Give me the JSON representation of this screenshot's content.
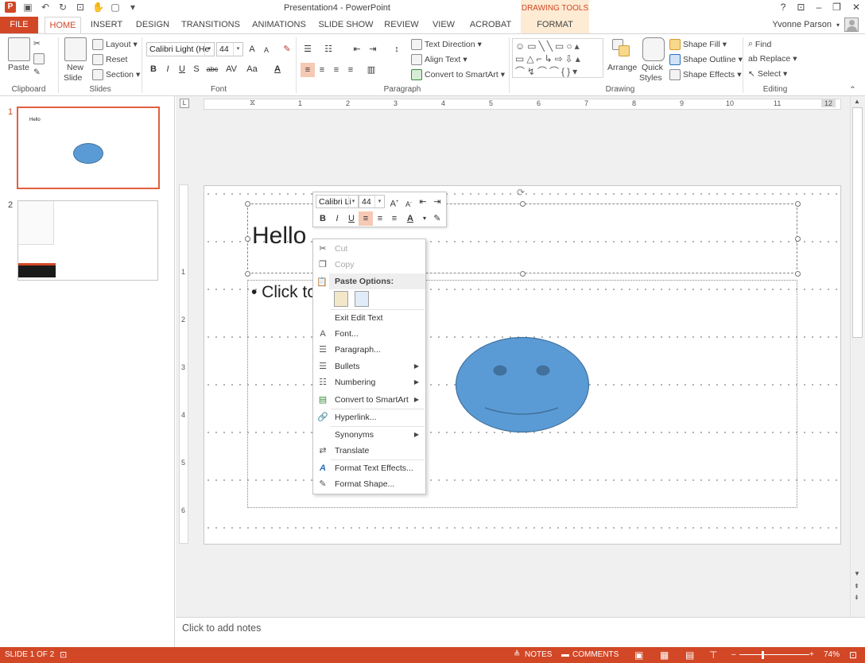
{
  "window": {
    "title": "Presentation4 - PowerPoint",
    "contextual_group": "DRAWING TOOLS",
    "help": "?",
    "controls": [
      "⊡",
      "–",
      "❐",
      "✕"
    ]
  },
  "tabs": {
    "file": "FILE",
    "home": "HOME",
    "insert": "INSERT",
    "design": "DESIGN",
    "transitions": "TRANSITIONS",
    "animations": "ANIMATIONS",
    "slide_show": "SLIDE SHOW",
    "review": "REVIEW",
    "view": "VIEW",
    "acrobat": "ACROBAT",
    "format": "FORMAT"
  },
  "user": {
    "name": "Yvonne Parson"
  },
  "ribbon": {
    "clipboard": {
      "label": "Clipboard",
      "paste": "Paste"
    },
    "slides": {
      "label": "Slides",
      "new_slide": "New",
      "new_slide2": "Slide",
      "layout": "Layout",
      "reset": "Reset",
      "section": "Section"
    },
    "font": {
      "label": "Font",
      "name": "Calibri Light (He",
      "size": "44",
      "bold": "B",
      "italic": "I",
      "underline": "U",
      "strike": "S",
      "shadow": "abc",
      "spacing": "AV",
      "case": "Aa",
      "color": "A",
      "grow": "A",
      "shrink": "A",
      "clear": "✎"
    },
    "paragraph": {
      "label": "Paragraph",
      "text_direction": "Text Direction",
      "align_text": "Align Text",
      "convert_smartart": "Convert to SmartArt"
    },
    "drawing": {
      "label": "Drawing",
      "arrange": "Arrange",
      "quick": "Quick",
      "styles": "Styles",
      "shape_fill": "Shape Fill",
      "shape_outline": "Shape Outline",
      "shape_effects": "Shape Effects"
    },
    "editing": {
      "label": "Editing",
      "find": "Find",
      "replace": "Replace",
      "select": "Select"
    }
  },
  "thumbnails": [
    {
      "num": "1",
      "text": "Hello"
    },
    {
      "num": "2"
    }
  ],
  "ruler": {
    "h": [
      "1",
      "2",
      "3",
      "4",
      "5",
      "6",
      "7",
      "8",
      "9",
      "10",
      "11",
      "12"
    ],
    "v": [
      "1",
      "2",
      "3",
      "4",
      "5",
      "6"
    ]
  },
  "slide": {
    "title": "Hello",
    "body": "• Click to"
  },
  "mini_toolbar": {
    "font": "Calibri Li",
    "size": "44",
    "bold": "B",
    "italic": "I",
    "underline": "U",
    "color": "A"
  },
  "context_menu": {
    "cut": "Cut",
    "copy": "Copy",
    "paste_options": "Paste Options:",
    "exit_edit_text": "Exit Edit Text",
    "font": "Font...",
    "paragraph": "Paragraph...",
    "bullets": "Bullets",
    "numbering": "Numbering",
    "convert_smartart": "Convert to SmartArt",
    "hyperlink": "Hyperlink...",
    "synonyms": "Synonyms",
    "translate": "Translate",
    "format_text_effects": "Format Text Effects...",
    "format_shape": "Format Shape..."
  },
  "notes": {
    "placeholder": "Click to add notes"
  },
  "status": {
    "slide": "SLIDE 1 OF 2",
    "notes": "NOTES",
    "comments": "COMMENTS",
    "zoom": "74%"
  },
  "colors": {
    "accent": "#d24726",
    "shape": "#5b9bd5"
  }
}
